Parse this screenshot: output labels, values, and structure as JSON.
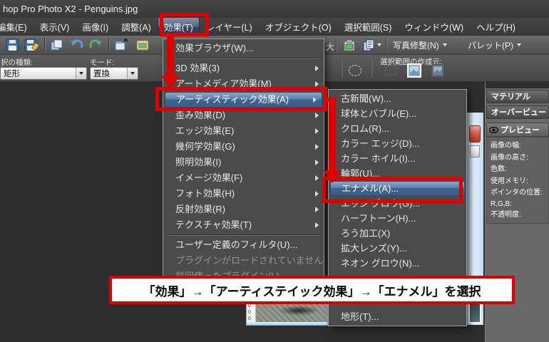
{
  "window": {
    "title": "hop Pro Photo X2 - Penguins.jpg"
  },
  "menubar": {
    "items": [
      {
        "label": "編集(E)"
      },
      {
        "label": "表示(V)"
      },
      {
        "label": "画像(I)"
      },
      {
        "label": "調整(A)"
      },
      {
        "label": "効果(T)",
        "open": true
      },
      {
        "label": "レイヤー(L)"
      },
      {
        "label": "オブジェクト(O)"
      },
      {
        "label": "選択範囲(S)"
      },
      {
        "label": "ウィンドウ(W)"
      },
      {
        "label": "ヘルプ(H)"
      }
    ]
  },
  "toolbar1": {
    "zoom_size_label": "大",
    "photo_fix_label": "写真修整(N)",
    "palette_label": "パレット(P)"
  },
  "toolbar2": {
    "selection_type_label": "択の種類:",
    "selection_type_value": "矩形",
    "mode_label": "モード:",
    "mode_value": "置換",
    "selection_source_label": "選択範囲の作成元:"
  },
  "effects_menu": {
    "items": [
      {
        "label": "効果ブラウザ(W)..."
      },
      {
        "label": "3D 効果(3)",
        "submenu": true
      },
      {
        "label": "アートメディア効果(M)",
        "submenu": true
      },
      {
        "label": "アーティスティック効果(A)",
        "submenu": true,
        "highlighted": true
      },
      {
        "label": "歪み効果(D)",
        "submenu": true
      },
      {
        "label": "エッジ効果(E)",
        "submenu": true
      },
      {
        "label": "幾何学効果(G)",
        "submenu": true
      },
      {
        "label": "照明効果(I)",
        "submenu": true
      },
      {
        "label": "イメージ効果(F)",
        "submenu": true
      },
      {
        "label": "フォト効果(H)",
        "submenu": true
      },
      {
        "label": "反射効果(R)",
        "submenu": true
      },
      {
        "label": "テクスチャ効果(T)",
        "submenu": true
      },
      {
        "label": "ユーザー定義のフィルタ(U)..."
      },
      {
        "label": "プラグインがロードされていません",
        "disabled": true
      },
      {
        "label": "前回使ったプラグイン(L)",
        "disabled": true
      }
    ]
  },
  "artistic_submenu": {
    "items": [
      {
        "label": "古新聞(W)..."
      },
      {
        "label": "球体とバブル(E)..."
      },
      {
        "label": "クロム(R)..."
      },
      {
        "label": "カラー エッジ(D)..."
      },
      {
        "label": "カラー ホイル(I)..."
      },
      {
        "label": "輪郭(U)..."
      },
      {
        "label": "エナメル(A)...",
        "highlighted": true
      },
      {
        "label": "エッジ グロウ(G)..."
      },
      {
        "label": "ハーフトーン(H)..."
      },
      {
        "label": "ろう加工(X)"
      },
      {
        "label": "拡大レンズ(Y)..."
      },
      {
        "label": "ネオン グロウ(N)..."
      },
      {
        "label": "地形(T)...",
        "bottom": true
      }
    ]
  },
  "right_panel": {
    "materials_title": "マテリアル",
    "overview_title": "オーバービュー",
    "preview_title": "プレビュー",
    "info_labels": [
      "画像の幅:",
      "画像の高さ:",
      "色数:",
      "使用メモリ:",
      "ポインタの位置:",
      "R,G,B:",
      "不透明度:"
    ]
  },
  "image_window": {
    "ruler_mark": "0"
  },
  "caption": {
    "text": "「効果」→「アーティステイック効果」→「エナメル」を選択"
  },
  "colors": {
    "annotation_red": "#e10000",
    "menu_highlight_blue": "#4f74a4"
  }
}
